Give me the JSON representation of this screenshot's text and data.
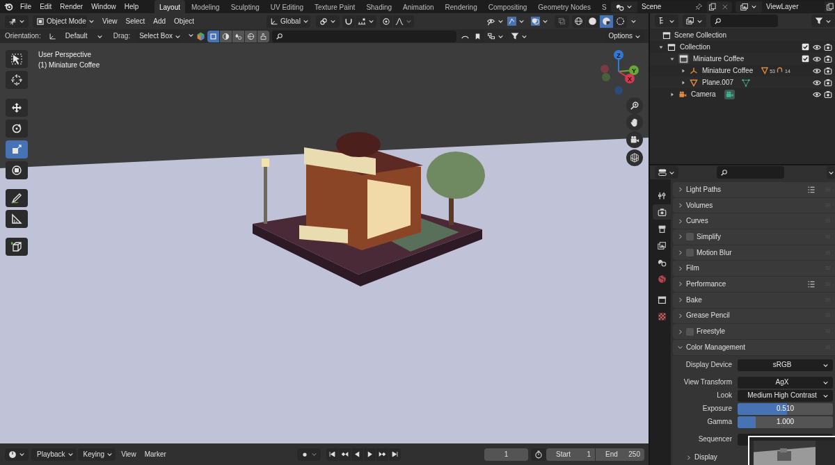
{
  "menu": [
    "File",
    "Edit",
    "Render",
    "Window",
    "Help"
  ],
  "workspaces": [
    {
      "label": "Layout",
      "selected": true
    },
    {
      "label": "Modeling",
      "selected": false
    },
    {
      "label": "Sculpting",
      "selected": false
    },
    {
      "label": "UV Editing",
      "selected": false
    },
    {
      "label": "Texture Paint",
      "selected": false
    },
    {
      "label": "Shading",
      "selected": false
    },
    {
      "label": "Animation",
      "selected": false
    },
    {
      "label": "Rendering",
      "selected": false
    },
    {
      "label": "Compositing",
      "selected": false
    },
    {
      "label": "Geometry Nodes",
      "selected": false
    },
    {
      "label": "S",
      "selected": false
    }
  ],
  "scene": {
    "name": "Scene"
  },
  "view_layer": {
    "name": "ViewLayer"
  },
  "viewport_header": {
    "mode": "Object Mode",
    "menus": [
      "View",
      "Select",
      "Add",
      "Object"
    ],
    "transform_orientation": "Global",
    "gizmos_on": true,
    "overlays_on": true,
    "shading": [
      {
        "kind": "wireframe",
        "selected": false
      },
      {
        "kind": "solid",
        "selected": false
      },
      {
        "kind": "material",
        "selected": true
      },
      {
        "kind": "rendered",
        "selected": false
      }
    ]
  },
  "tool_settings": {
    "orientation_label": "Orientation:",
    "orientation": "Default",
    "drag_label": "Drag:",
    "drag": "Select Box",
    "options": "Options",
    "select_modes": [
      {
        "kind": "set",
        "selected": true
      },
      {
        "kind": "extend",
        "selected": false
      },
      {
        "kind": "subtract",
        "selected": false
      },
      {
        "kind": "difference",
        "selected": false
      },
      {
        "kind": "intersect",
        "selected": false
      }
    ]
  },
  "viewport": {
    "info": [
      "User Perspective",
      "(1) Miniature Coffee"
    ],
    "axes": [
      {
        "label": "Z"
      },
      {
        "label": "Y"
      },
      {
        "label": "X"
      }
    ]
  },
  "toolbar": [
    {
      "kind": "select",
      "selected": false
    },
    {
      "kind": "cursor",
      "selected": false
    },
    {
      "kind": "move",
      "selected": false
    },
    {
      "kind": "rotate",
      "selected": false
    },
    {
      "kind": "scale",
      "selected": true
    },
    {
      "kind": "transform",
      "selected": false
    },
    {
      "kind": "annotate",
      "selected": false
    },
    {
      "kind": "measure",
      "selected": false
    },
    {
      "kind": "add_cube",
      "selected": false
    }
  ],
  "outliner": {
    "root": "Scene Collection",
    "tree": [
      {
        "label": "Collection",
        "kind": "collection",
        "expanded": true,
        "checked": true,
        "visible": true,
        "children": [
          {
            "label": "Miniature Coffee",
            "kind": "collection",
            "expanded": true,
            "checked": true,
            "visible": true,
            "children": [
              {
                "label": "Miniature Coffee",
                "kind": "empty",
                "expanded": false,
                "visible": true,
                "extras": [
                  {
                    "kind": "mesh",
                    "count": "53"
                  },
                  {
                    "kind": "curve",
                    "count": "14"
                  }
                ]
              },
              {
                "label": "Plane.007",
                "kind": "mesh",
                "expanded": false,
                "visible": true,
                "extras": [
                  {
                    "kind": "mesh_data"
                  }
                ]
              }
            ]
          },
          {
            "label": "Camera",
            "kind": "camera",
            "expanded": false,
            "visible": true,
            "extras": [
              {
                "kind": "camera_data"
              }
            ]
          }
        ]
      }
    ]
  },
  "properties": {
    "tabs": [
      {
        "kind": "tool",
        "selected": false
      },
      {
        "kind": "render",
        "selected": true
      },
      {
        "kind": "output",
        "selected": false
      },
      {
        "kind": "view_layer",
        "selected": false
      },
      {
        "kind": "scene",
        "selected": false
      },
      {
        "kind": "world",
        "selected": false
      },
      {
        "kind": "collection",
        "selected": false
      },
      {
        "kind": "texture",
        "selected": false
      }
    ],
    "panels": [
      {
        "label": "Light Paths",
        "expanded": false,
        "presets": true
      },
      {
        "label": "Volumes",
        "expanded": false
      },
      {
        "label": "Curves",
        "expanded": false
      },
      {
        "label": "Simplify",
        "expanded": false,
        "checked": false
      },
      {
        "label": "Motion Blur",
        "expanded": false,
        "checked": false
      },
      {
        "label": "Film",
        "expanded": false
      },
      {
        "label": "Performance",
        "expanded": false,
        "presets": true
      },
      {
        "label": "Bake",
        "expanded": false
      },
      {
        "label": "Grease Pencil",
        "expanded": false
      },
      {
        "label": "Freestyle",
        "expanded": false,
        "checked": false
      },
      {
        "label": "Color Management",
        "expanded": true,
        "fields": [
          {
            "label": "Display Device",
            "kind": "dropdown",
            "value": "sRGB"
          },
          {
            "label": "View Transform",
            "kind": "dropdown",
            "value": "AgX"
          },
          {
            "label": "Look",
            "kind": "dropdown",
            "value": "Medium High Contrast"
          },
          {
            "label": "Exposure",
            "kind": "slider",
            "value": "0.510",
            "level": 0.52
          },
          {
            "label": "Gamma",
            "kind": "slider",
            "value": "1.000",
            "level": 0.19
          },
          {
            "label": "Sequencer",
            "kind": "dropdown"
          }
        ],
        "subpanels": [
          {
            "label": "Display",
            "expanded": false
          }
        ]
      }
    ]
  },
  "timeline": {
    "menus": [
      {
        "label": "Playback",
        "dropdown": true
      },
      {
        "label": "Keying",
        "dropdown": true
      },
      {
        "label": "View",
        "dropdown": false
      },
      {
        "label": "Marker",
        "dropdown": false
      }
    ],
    "current_frame": "1",
    "start_label": "Start",
    "start": "1",
    "end_label": "End",
    "end": "250"
  }
}
